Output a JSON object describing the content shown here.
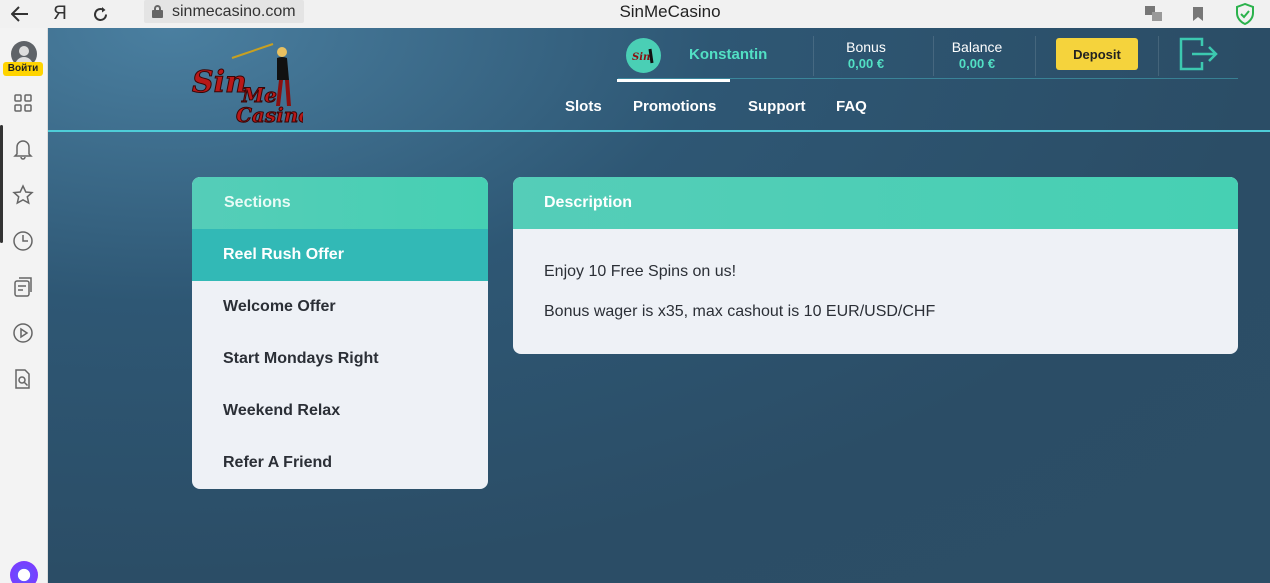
{
  "browser": {
    "url": "sinmecasino.com",
    "title": "SinMeCasino",
    "login_badge": "Войти",
    "back_icon": "arrow-left-icon",
    "yandex_icon": "yandex-logo-icon",
    "reload_icon": "reload-icon"
  },
  "header": {
    "logo_text": "SinMeCasino",
    "username": "Konstantin",
    "bonus_label": "Bonus",
    "bonus_value": "0,00 €",
    "balance_label": "Balance",
    "balance_value": "0,00 €",
    "deposit_label": "Deposit",
    "nav": [
      {
        "label": "Slots"
      },
      {
        "label": "Promotions",
        "active": true
      },
      {
        "label": "Support"
      },
      {
        "label": "FAQ"
      }
    ]
  },
  "sections": {
    "title": "Sections",
    "items": [
      {
        "label": "Reel Rush Offer",
        "active": true
      },
      {
        "label": "Welcome Offer"
      },
      {
        "label": "Start Mondays Right"
      },
      {
        "label": "Weekend Relax"
      },
      {
        "label": "Refer A Friend"
      }
    ]
  },
  "description": {
    "title": "Description",
    "lines": [
      "Enjoy 10 Free Spins on us!",
      "Bonus wager is x35, max cashout is 10 EUR/USD/CHF"
    ]
  },
  "colors": {
    "accent": "#46d0b3",
    "active_section": "#32b9b6",
    "deposit": "#f5d33c",
    "header_bg": "#2e5774"
  }
}
